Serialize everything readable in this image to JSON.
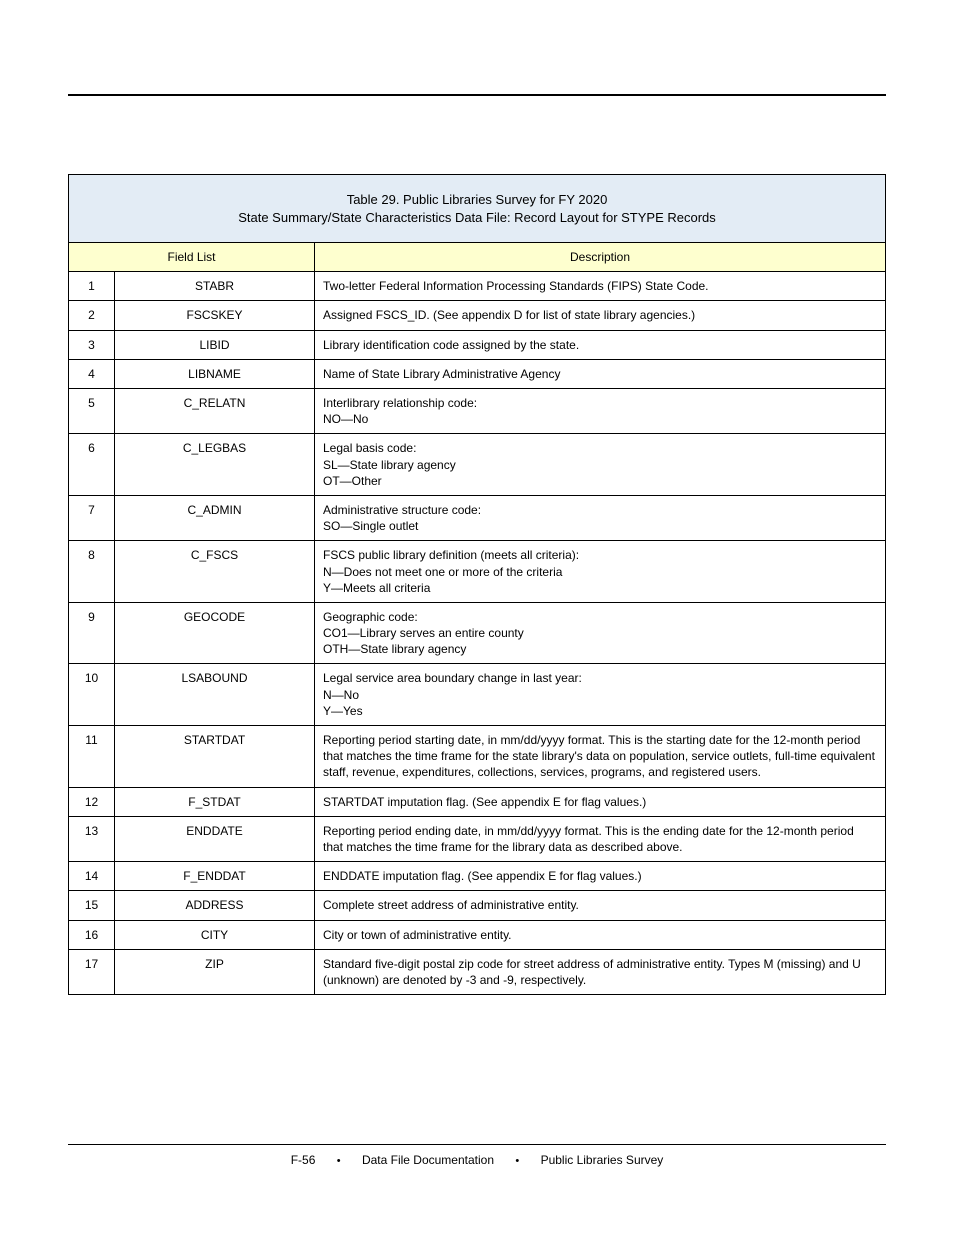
{
  "table": {
    "title_lines": [
      "Table 29.  Public Libraries Survey for FY 2020",
      "State Summary/State Characteristics Data File: Record Layout for STYPE Records"
    ],
    "header": {
      "field_list": "Field List",
      "description": "Description"
    },
    "rows": [
      {
        "num": "1",
        "field": "STABR",
        "desc": "Two-letter Federal Information Processing Standards (FIPS) State Code."
      },
      {
        "num": "2",
        "field": "FSCSKEY",
        "desc": "Assigned FSCS_ID. (See appendix D for list of state library agencies.)"
      },
      {
        "num": "3",
        "field": "LIBID",
        "desc": "Library identification code assigned by the state."
      },
      {
        "num": "4",
        "field": "LIBNAME",
        "desc": "Name of State Library Administrative Agency"
      },
      {
        "num": "5",
        "field": "C_RELATN",
        "desc": "Interlibrary relationship code:\nNO—No"
      },
      {
        "num": "6",
        "field": "C_LEGBAS",
        "desc": "Legal basis code:\nSL—State library agency\nOT—Other"
      },
      {
        "num": "7",
        "field": "C_ADMIN",
        "desc": "Administrative structure code:\nSO—Single outlet"
      },
      {
        "num": "8",
        "field": "C_FSCS",
        "desc": "FSCS public library definition (meets all criteria):\nN—Does not meet one or more of the criteria\nY—Meets all criteria"
      },
      {
        "num": "9",
        "field": "GEOCODE",
        "desc": "Geographic code:\nCO1—Library serves an entire county\nOTH—State library agency"
      },
      {
        "num": "10",
        "field": "LSABOUND",
        "desc": "Legal service area boundary change in last year:\nN—No\nY—Yes"
      },
      {
        "num": "11",
        "field": "STARTDAT",
        "desc": "Reporting period starting date, in mm/dd/yyyy format. This is the starting date for the 12-month period that matches the time frame for the state library's data on population, service outlets, full-time equivalent staff, revenue, expenditures, collections, services, programs, and registered users."
      },
      {
        "num": "12",
        "field": "F_STDAT",
        "desc": "STARTDAT imputation flag. (See appendix E for flag values.)"
      },
      {
        "num": "13",
        "field": "ENDDATE",
        "desc": "Reporting period ending date, in mm/dd/yyyy format. This is the ending date for the 12-month period that matches the time frame for the library data as described above."
      },
      {
        "num": "14",
        "field": "F_ENDDAT",
        "desc": "ENDDATE imputation flag. (See appendix E for flag values.)"
      },
      {
        "num": "15",
        "field": "ADDRESS",
        "desc": "Complete street address of administrative entity."
      },
      {
        "num": "16",
        "field": "CITY",
        "desc": "City or town of administrative entity."
      },
      {
        "num": "17",
        "field": "ZIP",
        "desc": "Standard five-digit postal zip code for street address of administrative entity. Types M (missing) and U (unknown) are denoted by -3 and -9, respectively."
      }
    ]
  },
  "footer": {
    "left": "F-56",
    "middle": "Data File Documentation",
    "right": "Public Libraries Survey"
  }
}
